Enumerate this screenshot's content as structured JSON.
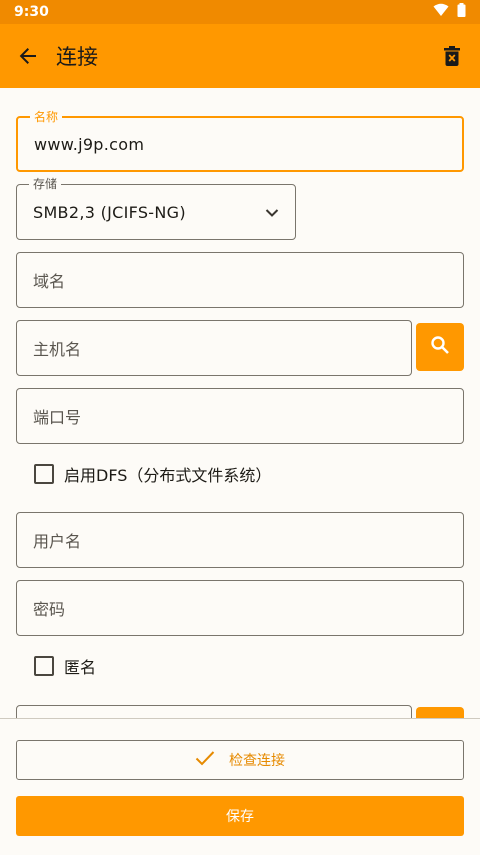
{
  "status_bar": {
    "time": "9:30",
    "icons": [
      "wifi-icon",
      "battery-icon"
    ]
  },
  "app_bar": {
    "title": "连接",
    "back_icon": "arrow-back-icon",
    "delete_icon": "delete-icon"
  },
  "form": {
    "name": {
      "label": "名称",
      "value": "www.j9p.com"
    },
    "storage": {
      "label": "存储",
      "value": "SMB2,3 (JCIFS-NG)"
    },
    "domain": {
      "placeholder": "域名"
    },
    "host": {
      "placeholder": "主机名"
    },
    "port": {
      "placeholder": "端口号"
    },
    "dfs_checkbox": {
      "label": "启用DFS（分布式文件系统）",
      "checked": false
    },
    "username": {
      "placeholder": "用户名"
    },
    "password": {
      "placeholder": "密码"
    },
    "anonymous_checkbox": {
      "label": "匿名",
      "checked": false
    }
  },
  "actions": {
    "check_label": "检查连接",
    "save_label": "保存"
  },
  "colors": {
    "accent": "#ff9800",
    "status_bar": "#f08a00",
    "background": "#fdfbf7"
  }
}
